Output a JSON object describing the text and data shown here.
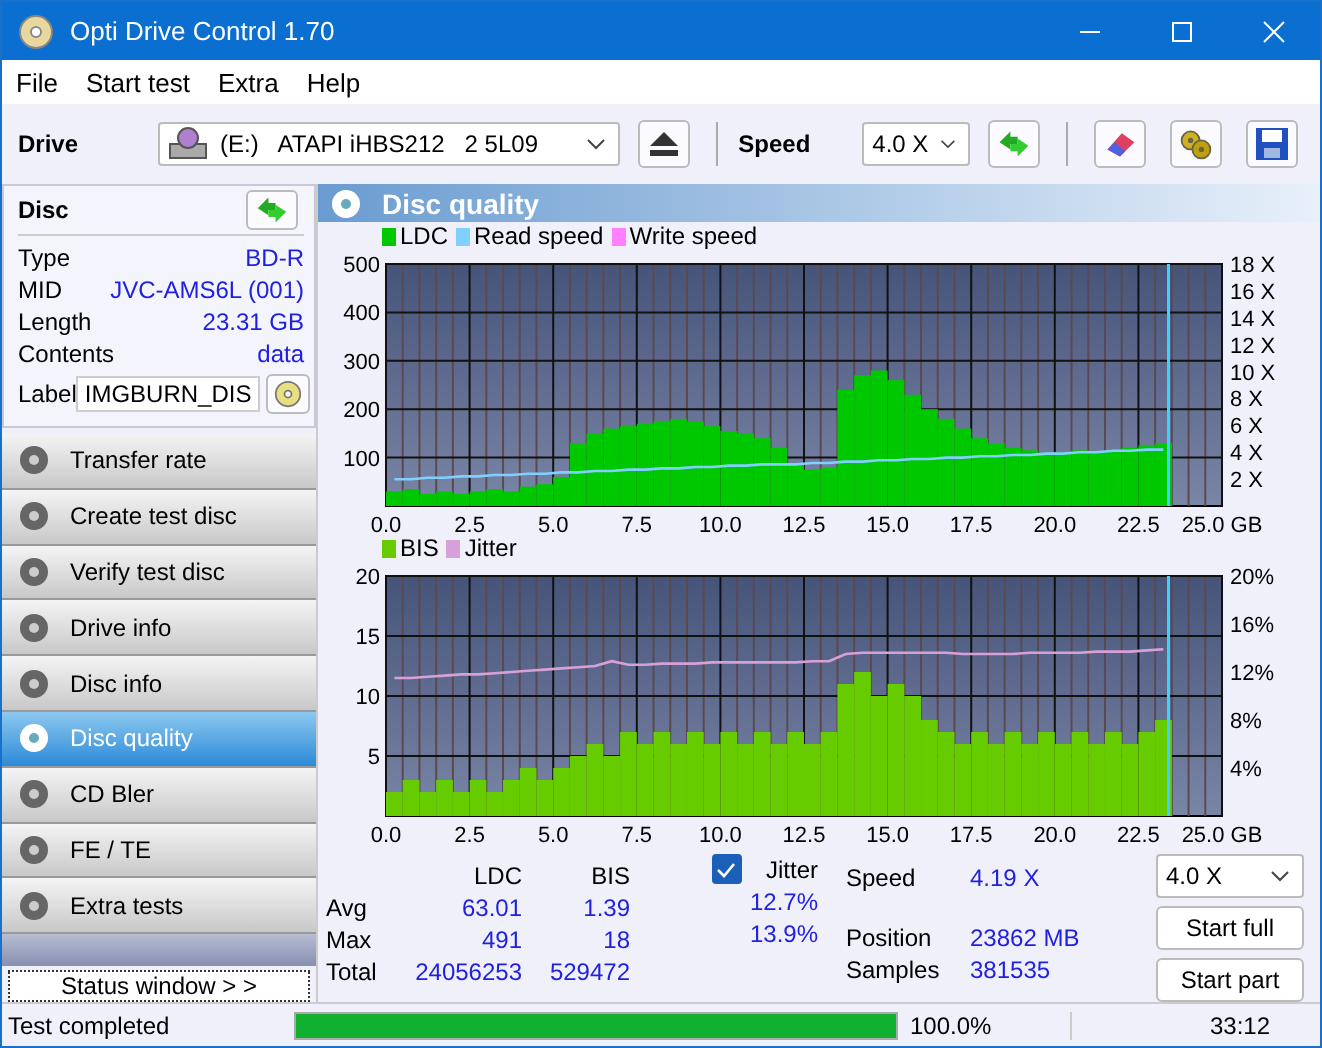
{
  "window": {
    "title": "Opti Drive Control 1.70"
  },
  "menu": [
    {
      "label": "File"
    },
    {
      "label": "Start test"
    },
    {
      "label": "Extra"
    },
    {
      "label": "Help"
    }
  ],
  "toolbar": {
    "drive_label": "Drive",
    "drive": "(E:)   ATAPI iHBS212   2 5L09",
    "speed_label": "Speed",
    "speed": "4.0 X"
  },
  "disc": {
    "title": "Disc",
    "fields": [
      {
        "label": "Type",
        "value": "BD-R"
      },
      {
        "label": "MID",
        "value": "JVC-AMS6L (001)"
      },
      {
        "label": "Length",
        "value": "23.31 GB"
      },
      {
        "label": "Contents",
        "value": "data"
      }
    ],
    "label_field": {
      "label": "Label",
      "value": "IMGBURN_DIS"
    }
  },
  "sidebar": {
    "items": [
      {
        "label": "Transfer rate",
        "selected": false
      },
      {
        "label": "Create test disc",
        "selected": false
      },
      {
        "label": "Verify test disc",
        "selected": false
      },
      {
        "label": "Drive info",
        "selected": false
      },
      {
        "label": "Disc info",
        "selected": false
      },
      {
        "label": "Disc quality",
        "selected": true
      },
      {
        "label": "CD Bler",
        "selected": false
      },
      {
        "label": "FE / TE",
        "selected": false
      },
      {
        "label": "Extra tests",
        "selected": false
      }
    ],
    "status_button": "Status window > >"
  },
  "panel": {
    "title": "Disc quality",
    "charts": [
      {
        "chart_data": {
          "type": "bar",
          "grid": true,
          "legend": "top",
          "xlim": [
            0,
            25
          ],
          "ylim": [
            0,
            500
          ],
          "y2lim": [
            0,
            18
          ],
          "x": [
            0.25,
            0.75,
            1.25,
            1.75,
            2.25,
            2.75,
            3.25,
            3.75,
            4.25,
            4.75,
            5.25,
            5.75,
            6.25,
            6.75,
            7.25,
            7.75,
            8.25,
            8.75,
            9.25,
            9.75,
            10.25,
            10.75,
            11.25,
            11.75,
            12.25,
            12.75,
            13.25,
            13.75,
            14.25,
            14.75,
            15.25,
            15.75,
            16.25,
            16.75,
            17.25,
            17.75,
            18.25,
            18.75,
            19.25,
            19.75,
            20.25,
            20.75,
            21.25,
            21.75,
            22.25,
            22.75,
            23.25
          ],
          "xticks": [
            {
              "value": 0,
              "label": "0.0"
            },
            {
              "value": 2.5,
              "label": "2.5"
            },
            {
              "value": 5,
              "label": "5.0"
            },
            {
              "value": 7.5,
              "label": "7.5"
            },
            {
              "value": 10,
              "label": "10.0"
            },
            {
              "value": 12.5,
              "label": "12.5"
            },
            {
              "value": 15,
              "label": "15.0"
            },
            {
              "value": 17.5,
              "label": "17.5"
            },
            {
              "value": 20,
              "label": "20.0"
            },
            {
              "value": 22.5,
              "label": "22.5"
            },
            {
              "value": 25,
              "label": "25.0 GB"
            }
          ],
          "yticks": [
            100,
            200,
            300,
            400,
            500
          ],
          "y2ticks": [
            {
              "value": 2,
              "label": "2 X"
            },
            {
              "value": 4,
              "label": "4 X"
            },
            {
              "value": 6,
              "label": "6 X"
            },
            {
              "value": 8,
              "label": "8 X"
            },
            {
              "value": 10,
              "label": "10 X"
            },
            {
              "value": 12,
              "label": "12 X"
            },
            {
              "value": 14,
              "label": "14 X"
            },
            {
              "value": 16,
              "label": "16 X"
            },
            {
              "value": 18,
              "label": "18 X"
            }
          ],
          "ref_lines": [
            {
              "axis": "x",
              "value": 23.4,
              "color": "#40d0ff"
            }
          ],
          "series": [
            {
              "name": "LDC",
              "color": "#00c800",
              "values": [
                30,
                35,
                25,
                30,
                25,
                30,
                35,
                30,
                40,
                45,
                60,
                130,
                150,
                160,
                165,
                170,
                175,
                180,
                175,
                165,
                155,
                150,
                140,
                120,
                85,
                75,
                80,
                240,
                270,
                280,
                260,
                230,
                200,
                180,
                160,
                140,
                130,
                120,
                115,
                110,
                112,
                115,
                110,
                115,
                120,
                125,
                130
              ]
            },
            {
              "name": "Read speed",
              "type": "line",
              "axis": "y2",
              "color": "#80d0ff",
              "values": [
                2.0,
                2.0,
                2.1,
                2.1,
                2.2,
                2.2,
                2.3,
                2.3,
                2.4,
                2.4,
                2.5,
                2.5,
                2.6,
                2.6,
                2.7,
                2.7,
                2.8,
                2.8,
                2.9,
                2.9,
                3.0,
                3.0,
                3.1,
                3.1,
                3.1,
                3.2,
                3.2,
                3.3,
                3.3,
                3.4,
                3.4,
                3.5,
                3.5,
                3.6,
                3.6,
                3.7,
                3.7,
                3.8,
                3.8,
                3.9,
                3.9,
                4.0,
                4.0,
                4.1,
                4.1,
                4.2,
                4.2
              ]
            },
            {
              "name": "Write speed",
              "type": "line",
              "color": "#ff80ff",
              "values": [
                null,
                null,
                null,
                null,
                null,
                null,
                null,
                null,
                null,
                null,
                null,
                null,
                null,
                null,
                null,
                null,
                null,
                null,
                null,
                null,
                null,
                null,
                null,
                null,
                null,
                null,
                null,
                null,
                null,
                null,
                null,
                null,
                null,
                null,
                null,
                null,
                null,
                null,
                null,
                null,
                null,
                null,
                null,
                null,
                null,
                null,
                null
              ]
            }
          ]
        }
      },
      {
        "chart_data": {
          "type": "bar",
          "grid": true,
          "legend": "top",
          "xlim": [
            0,
            25
          ],
          "ylim": [
            0,
            20
          ],
          "y2lim": [
            0,
            20
          ],
          "x": [
            0.25,
            0.75,
            1.25,
            1.75,
            2.25,
            2.75,
            3.25,
            3.75,
            4.25,
            4.75,
            5.25,
            5.75,
            6.25,
            6.75,
            7.25,
            7.75,
            8.25,
            8.75,
            9.25,
            9.75,
            10.25,
            10.75,
            11.25,
            11.75,
            12.25,
            12.75,
            13.25,
            13.75,
            14.25,
            14.75,
            15.25,
            15.75,
            16.25,
            16.75,
            17.25,
            17.75,
            18.25,
            18.75,
            19.25,
            19.75,
            20.25,
            20.75,
            21.25,
            21.75,
            22.25,
            22.75,
            23.25
          ],
          "xticks": [
            {
              "value": 0,
              "label": "0.0"
            },
            {
              "value": 2.5,
              "label": "2.5"
            },
            {
              "value": 5,
              "label": "5.0"
            },
            {
              "value": 7.5,
              "label": "7.5"
            },
            {
              "value": 10,
              "label": "10.0"
            },
            {
              "value": 12.5,
              "label": "12.5"
            },
            {
              "value": 15,
              "label": "15.0"
            },
            {
              "value": 17.5,
              "label": "17.5"
            },
            {
              "value": 20,
              "label": "20.0"
            },
            {
              "value": 22.5,
              "label": "22.5"
            },
            {
              "value": 25,
              "label": "25.0 GB"
            }
          ],
          "yticks": [
            5,
            10,
            15,
            20
          ],
          "y2ticks": [
            {
              "value": 4,
              "label": "4%"
            },
            {
              "value": 8,
              "label": "8%"
            },
            {
              "value": 12,
              "label": "12%"
            },
            {
              "value": 16,
              "label": "16%"
            },
            {
              "value": 20,
              "label": "20%"
            }
          ],
          "ref_lines": [
            {
              "axis": "x",
              "value": 23.4,
              "color": "#40d0ff"
            }
          ],
          "series": [
            {
              "name": "BIS",
              "color": "#66cc00",
              "values": [
                2,
                3,
                2,
                3,
                2,
                3,
                2,
                3,
                4,
                3,
                4,
                5,
                6,
                5,
                7,
                6,
                7,
                6,
                7,
                6,
                7,
                6,
                7,
                6,
                7,
                6,
                7,
                11,
                12,
                10,
                11,
                10,
                8,
                7,
                6,
                7,
                6,
                7,
                6,
                7,
                6,
                7,
                6,
                7,
                6,
                7,
                8
              ]
            },
            {
              "name": "Jitter",
              "type": "line",
              "axis": "y2",
              "color": "#d8a0d8",
              "values": [
                11.5,
                11.5,
                11.6,
                11.7,
                11.8,
                11.8,
                11.9,
                12.0,
                12.1,
                12.2,
                12.3,
                12.4,
                12.5,
                12.9,
                12.6,
                12.6,
                12.7,
                12.7,
                12.7,
                12.8,
                12.8,
                12.8,
                12.8,
                12.8,
                12.8,
                12.9,
                12.9,
                13.5,
                13.6,
                13.6,
                13.6,
                13.6,
                13.6,
                13.6,
                13.5,
                13.5,
                13.5,
                13.5,
                13.6,
                13.6,
                13.6,
                13.6,
                13.7,
                13.7,
                13.7,
                13.8,
                13.9
              ]
            }
          ]
        }
      }
    ]
  },
  "stats": {
    "columns": [
      "LDC",
      "BIS"
    ],
    "rows": [
      {
        "label": "Avg",
        "values": [
          "63.01",
          "1.39"
        ],
        "jitter": "12.7%"
      },
      {
        "label": "Max",
        "values": [
          "491",
          "18"
        ],
        "jitter": "13.9%"
      },
      {
        "label": "Total",
        "values": [
          "24056253",
          "529472"
        ]
      }
    ],
    "jitter": {
      "label": "Jitter",
      "checked": true
    },
    "info": [
      {
        "label": "Speed",
        "value": "4.19 X"
      },
      {
        "label": "Position",
        "value": "23862 MB"
      },
      {
        "label": "Samples",
        "value": "381535"
      }
    ],
    "speed": "4.0 X",
    "buttons": [
      "Start full",
      "Start part"
    ]
  },
  "status_bar": {
    "text": "Test completed",
    "level": 1,
    "percent": "100.0%",
    "time": "33:12"
  }
}
